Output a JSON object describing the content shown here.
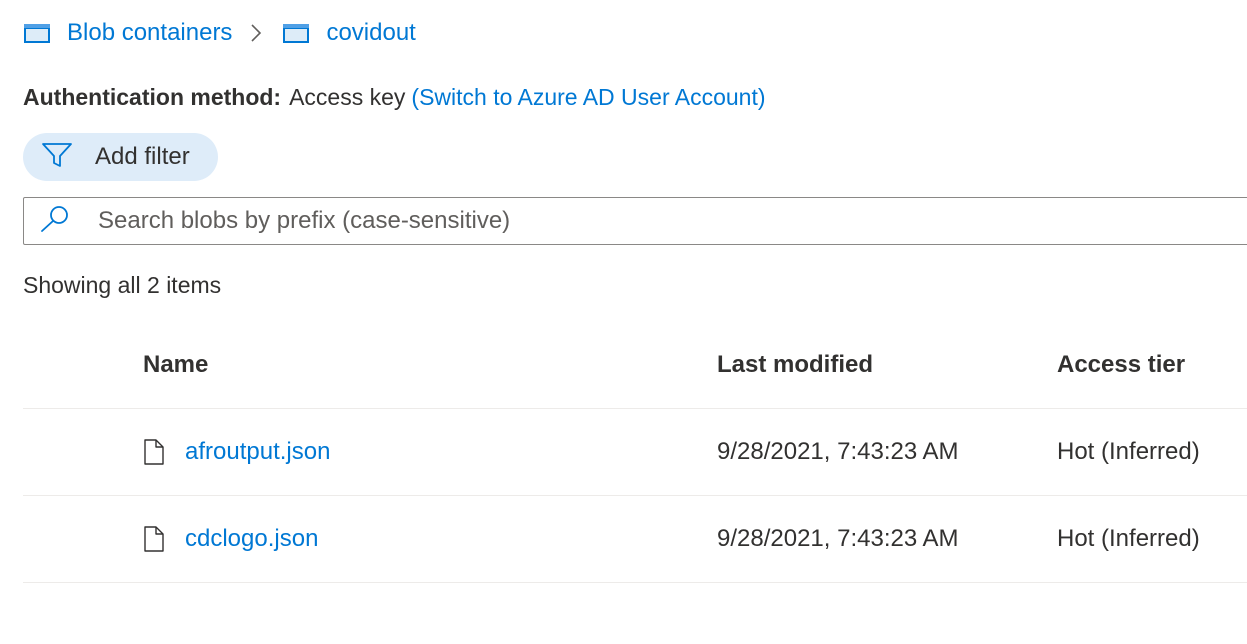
{
  "breadcrumb": {
    "items": [
      {
        "label": "Blob containers",
        "icon": "container-icon"
      },
      {
        "label": "covidout",
        "icon": "container-icon"
      }
    ],
    "separator_icon": "chevron-right-icon"
  },
  "auth": {
    "label": "Authentication method:",
    "value": "Access key",
    "switch_link": "(Switch to Azure AD User Account)"
  },
  "filter": {
    "label": "Add filter",
    "icon": "filter-icon"
  },
  "search": {
    "placeholder": "Search blobs by prefix (case-sensitive)",
    "value": "",
    "icon": "search-icon"
  },
  "count_text": "Showing all 2 items",
  "table": {
    "columns": [
      "Name",
      "Last modified",
      "Access tier"
    ],
    "rows": [
      {
        "name": "afroutput.json",
        "last_modified": "9/28/2021, 7:43:23 AM",
        "access_tier": "Hot (Inferred)",
        "icon": "file-icon"
      },
      {
        "name": "cdclogo.json",
        "last_modified": "9/28/2021, 7:43:23 AM",
        "access_tier": "Hot (Inferred)",
        "icon": "file-icon"
      }
    ]
  },
  "colors": {
    "accent": "#0078d4",
    "filter_bg": "#deecf9",
    "text": "#323130",
    "divider": "#edebe9"
  }
}
